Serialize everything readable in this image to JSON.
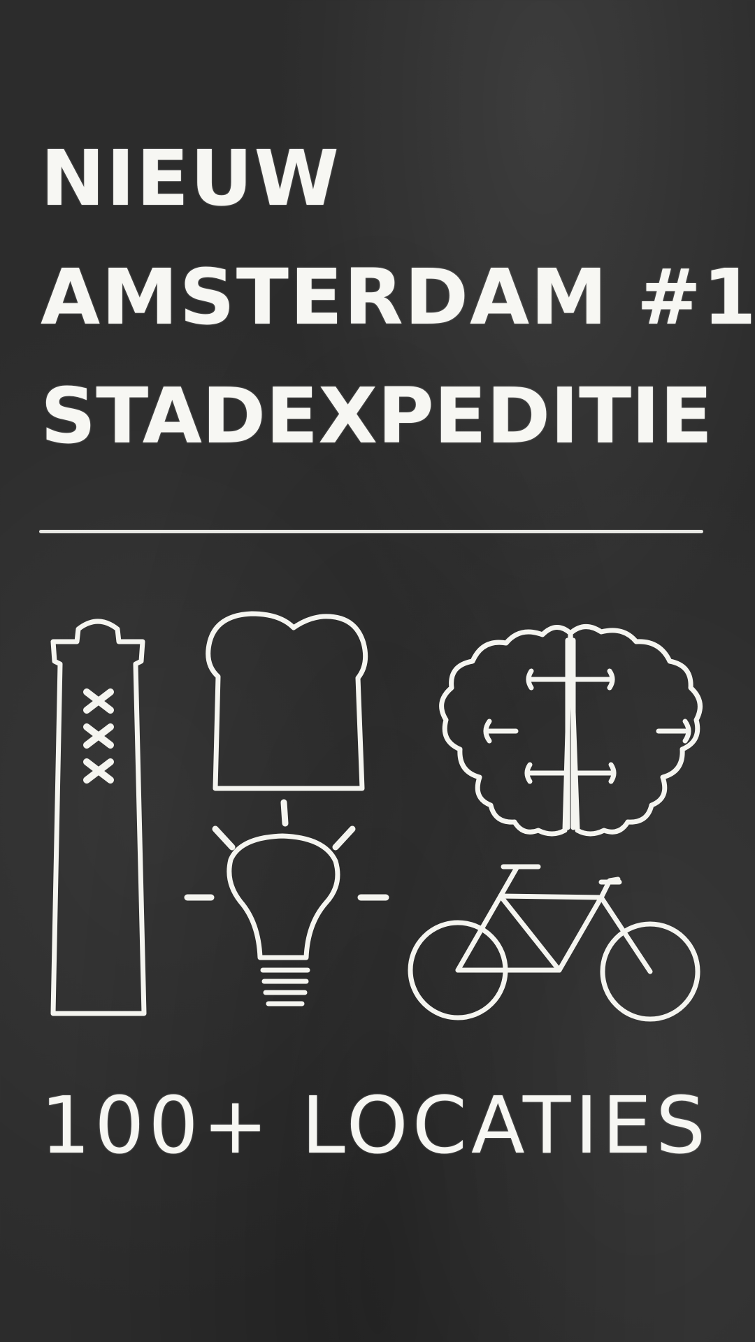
{
  "title": {
    "line1": "NIEUW",
    "line2": "AMSTERDAM #1",
    "line3": "STADEXPEDITIE"
  },
  "footer": {
    "label": "100+ LOCATIES"
  },
  "icons": [
    "amsterdammertje-bollard-icon",
    "bread-icon",
    "brain-icon",
    "lightbulb-icon",
    "bicycle-icon"
  ],
  "colors": {
    "background": "#2c2c2c",
    "chalk": "#f7f7f3"
  }
}
